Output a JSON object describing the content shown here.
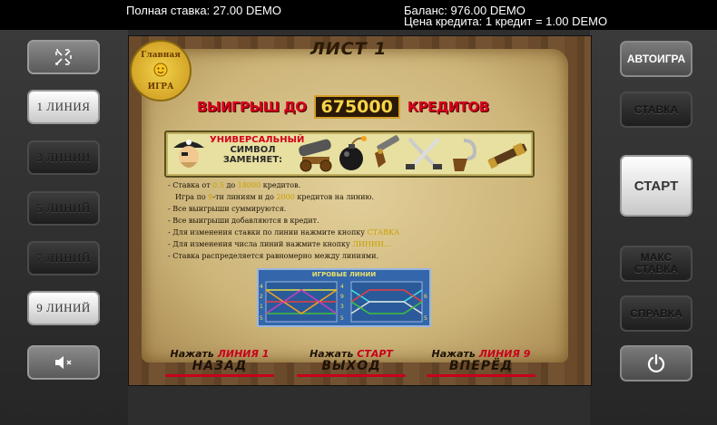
{
  "topbar": {
    "total_bet": "Полная ставка: 27.00 DEMO",
    "balance": "Баланс: 976.00 DEMO",
    "credit_price": "Цена кредита: 1 кредит = 1.00 DEMO"
  },
  "left_buttons": {
    "fullscreen_icon": "fullscreen-icon",
    "lines": [
      "1 ЛИНИЯ",
      "3 ЛИНИИ",
      "5 ЛИНИЙ",
      "7 ЛИНИЙ",
      "9 ЛИНИЙ"
    ],
    "sound_icon": "mute-icon"
  },
  "right_buttons": {
    "autoplay": "АВТОИГРА",
    "bet": "СТАВКА",
    "start": "СТАРТ",
    "max_bet_line1": "МАКС",
    "max_bet_line2": "СТАВКА",
    "help": "СПРАВКА",
    "power_icon": "power-icon"
  },
  "help_page": {
    "title": "ЛИСТ 1",
    "logo_line1": "Главная",
    "logo_line2": "ИГРА",
    "wins_prefix": "ВЫИГРЫШ ДО",
    "wins_value": "675000",
    "wins_suffix": "КРЕДИТОВ",
    "wild_line1": "УНИВЕРСАЛЬНЫЙ",
    "wild_line2": "СИМВОЛ",
    "wild_line3": "ЗАМЕНЯЕТ:",
    "rules": {
      "r1_a": "- Ставка от ",
      "r1_b": "0.5",
      "r1_c": " до ",
      "r1_d": "18000",
      "r1_e": " кредитов.",
      "r2_a": "Игра по ",
      "r2_b": "9",
      "r2_c": "-ти линиям и до ",
      "r2_d": "2000",
      "r2_e": " кредитов на линию.",
      "r3": "- Все выигрыши суммируются.",
      "r4": "- Все выигрыши добавляются в кредит.",
      "r5_a": "- Для изменения ставки по линии нажмите кнопку ",
      "r5_b": "СТАВКА",
      "r6_a": "- Для изменения числа линий нажмите кнопку ",
      "r6_b": "ЛИНИИ...",
      "r7": "- Ставка распределяется равномерно между линиями."
    },
    "paylines_label": "ИГРОВЫЕ ЛИНИИ",
    "paylines_numbers_left": [
      "4",
      "2",
      "8",
      "1",
      "9",
      "7",
      "3",
      "5"
    ],
    "paylines_numbers_mid": [
      "4",
      "2",
      "8",
      "1",
      "9",
      "7",
      "3",
      "5"
    ],
    "paylines_numbers_right": [
      "6",
      "5"
    ],
    "nav": {
      "back_press": "Нажать",
      "back_key": "ЛИНИЯ 1",
      "back_label": "НАЗАД",
      "exit_press": "Нажать",
      "exit_key": "СТАРТ",
      "exit_label": "ВЫХОД",
      "next_press": "Нажать",
      "next_key": "ЛИНИЯ 9",
      "next_label": "ВПЕРЁД"
    }
  },
  "colors": {
    "accent_red": "#d4001e",
    "gold": "#f7d34a",
    "panel_dark": "#2e2e2e"
  }
}
